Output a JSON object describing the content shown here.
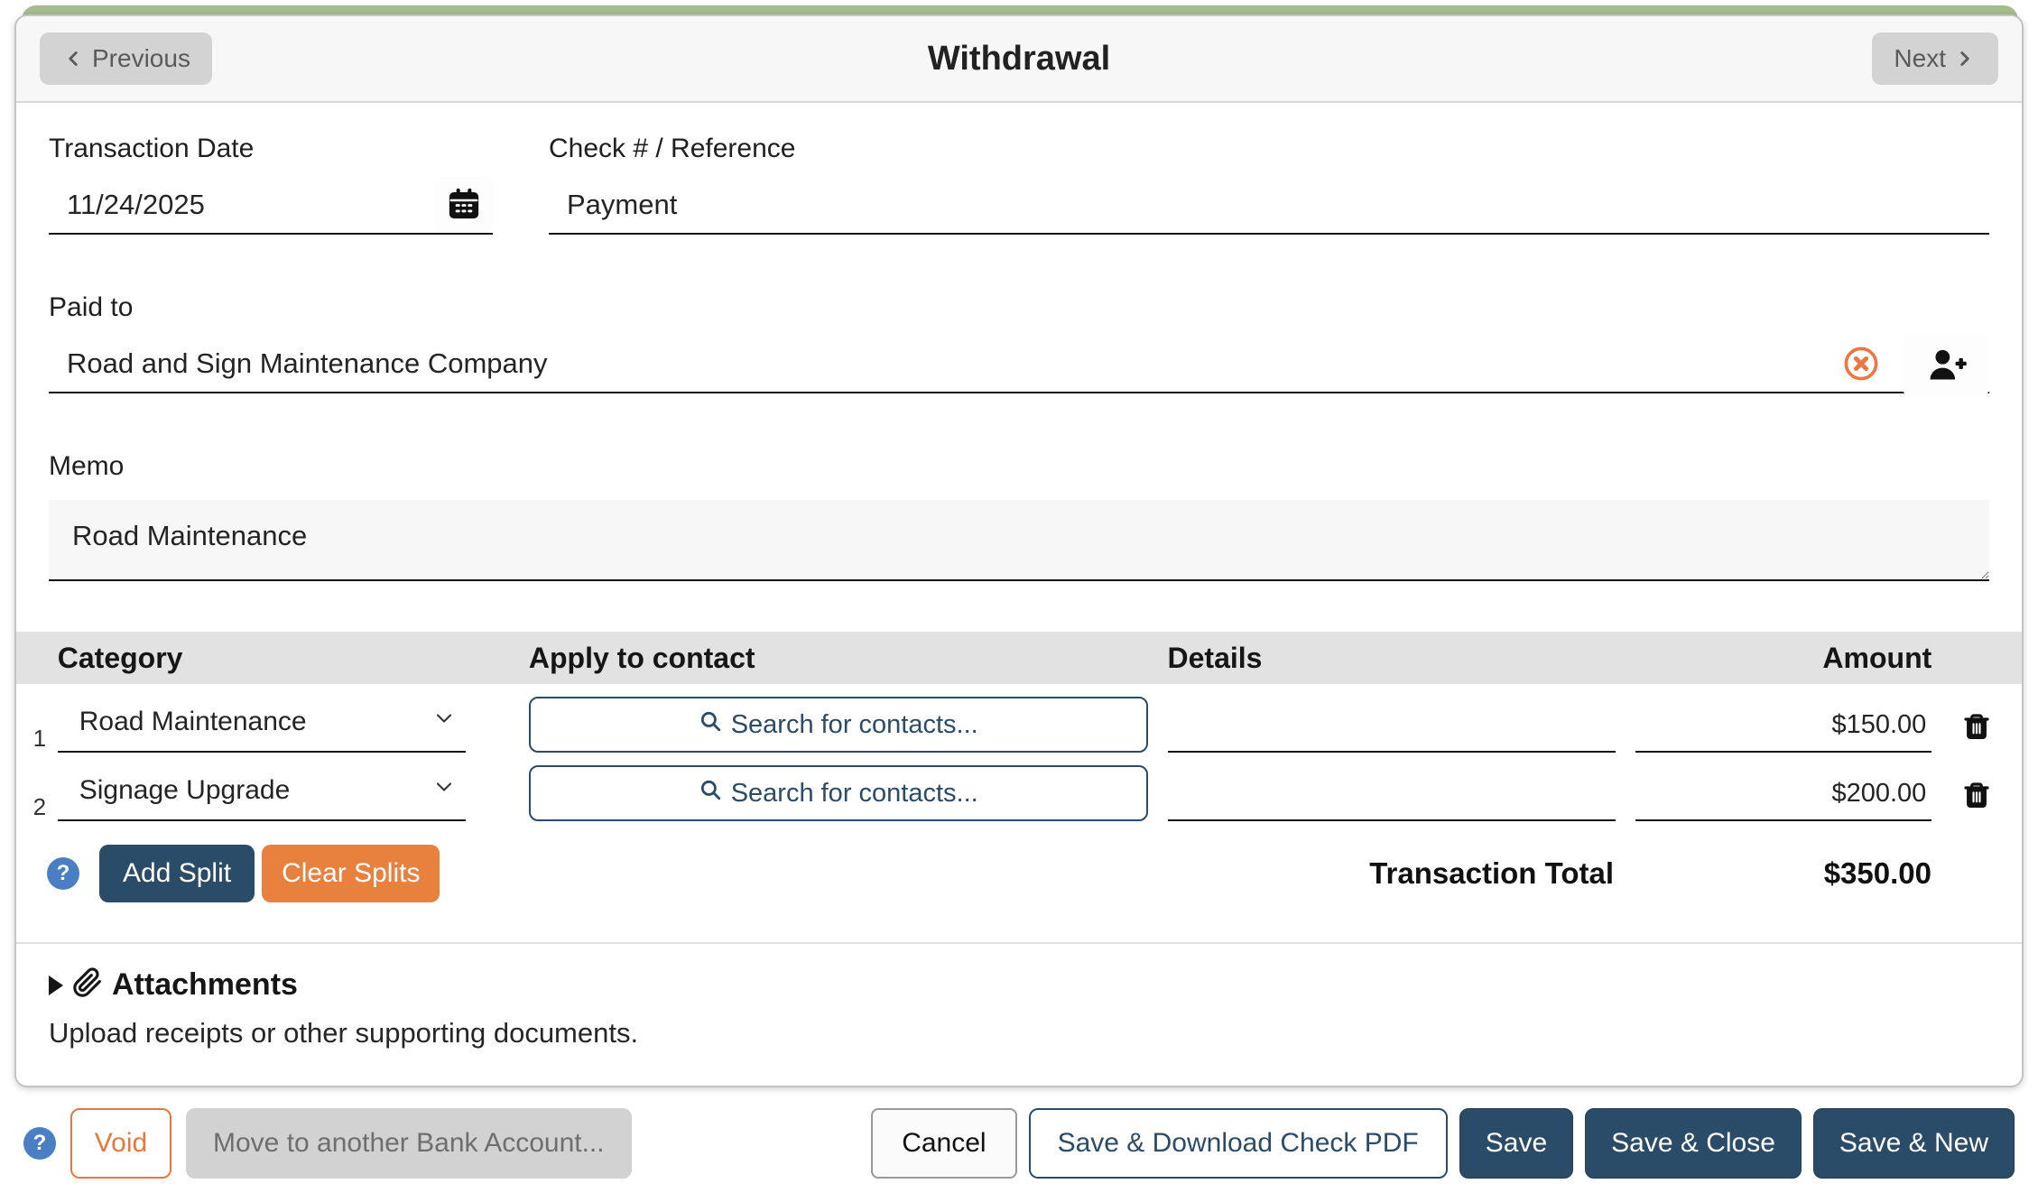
{
  "header": {
    "previous": "Previous",
    "title": "Withdrawal",
    "next": "Next"
  },
  "form": {
    "transaction_date": {
      "label": "Transaction Date",
      "value": "11/24/2025"
    },
    "check_reference": {
      "label": "Check # / Reference",
      "value": "Payment"
    },
    "paid_to": {
      "label": "Paid to",
      "value": "Road and Sign Maintenance Company"
    },
    "memo": {
      "label": "Memo",
      "value": "Road Maintenance"
    }
  },
  "splits": {
    "headers": {
      "category": "Category",
      "contact": "Apply to contact",
      "details": "Details",
      "amount": "Amount"
    },
    "rows": [
      {
        "num": "1",
        "category": "Road Maintenance",
        "contact_placeholder": "Search for contacts...",
        "details": "",
        "amount": "$150.00"
      },
      {
        "num": "2",
        "category": "Signage Upgrade",
        "contact_placeholder": "Search for contacts...",
        "details": "",
        "amount": "$200.00"
      }
    ],
    "add_split": "Add Split",
    "clear_splits": "Clear Splits",
    "help": "?",
    "total_label": "Transaction Total",
    "total_value": "$350.00"
  },
  "attachments": {
    "title": "Attachments",
    "description": "Upload receipts or other supporting documents."
  },
  "footer": {
    "help": "?",
    "void": "Void",
    "move": "Move to another Bank Account...",
    "cancel": "Cancel",
    "save_pdf": "Save & Download Check PDF",
    "save": "Save",
    "save_close": "Save & Close",
    "save_new": "Save & New"
  },
  "colors": {
    "accent_green": "#a4bd8c",
    "navy": "#2b4c68",
    "orange": "#e8803e",
    "help_blue": "#4a7fc4",
    "clear_icon_orange": "#ed7742"
  }
}
